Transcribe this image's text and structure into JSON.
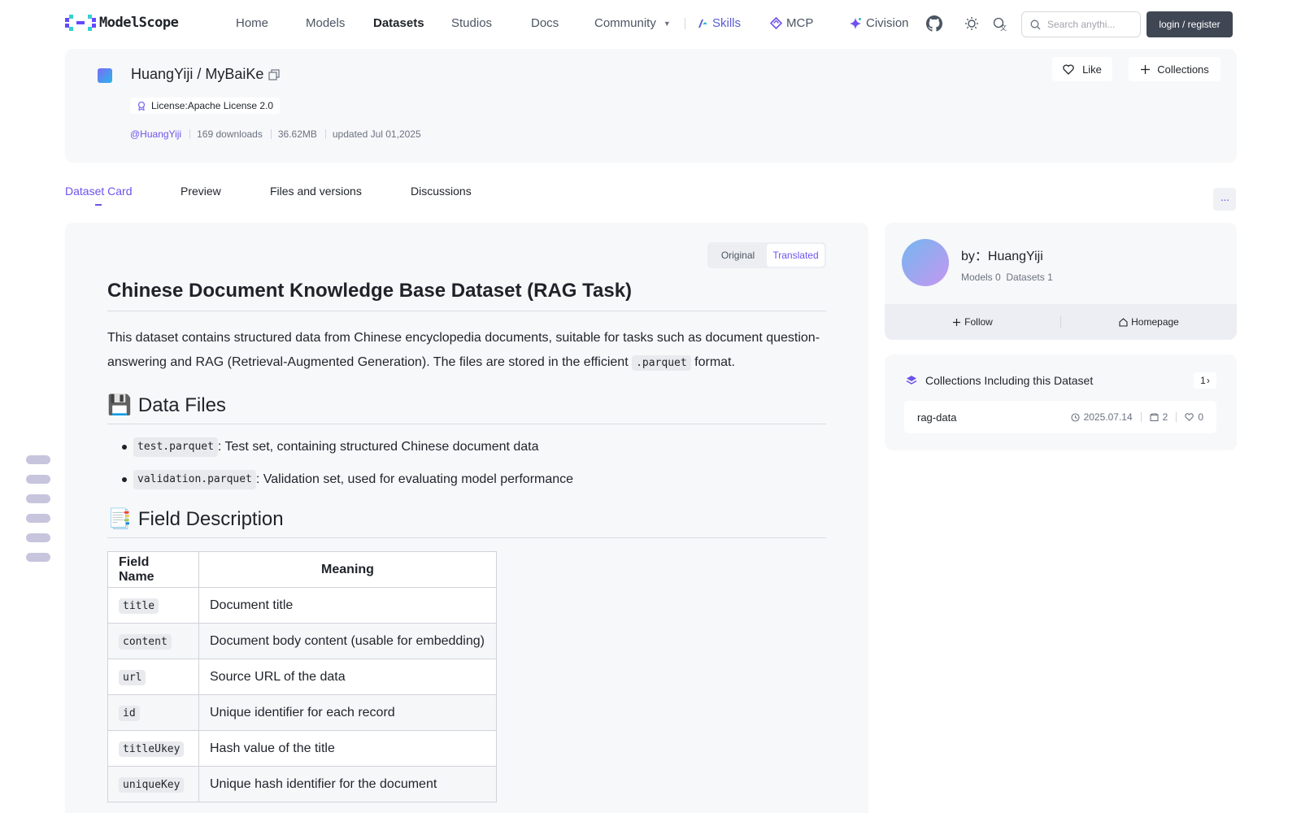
{
  "brand": {
    "logo_text": "ModelScope"
  },
  "nav": {
    "home": "Home",
    "models": "Models",
    "datasets": "Datasets",
    "studios": "Studios",
    "docs": "Docs",
    "community": "Community",
    "skills": "Skills",
    "mcp": "MCP",
    "civision": "Civision"
  },
  "search": {
    "placeholder": "Search anythi..."
  },
  "auth": {
    "login_label": "login / register"
  },
  "dataset": {
    "title": "HuangYiji / MyBaiKe",
    "license": "License:Apache License 2.0",
    "author": "@HuangYiji",
    "downloads": "169 downloads",
    "size": "36.62MB",
    "updated": "updated Jul 01,2025",
    "like_label": "Like",
    "collections_label": "Collections"
  },
  "tabs": {
    "card": "Dataset Card",
    "preview": "Preview",
    "files": "Files and versions",
    "discussions": "Discussions",
    "more": "···"
  },
  "lang_toggle": {
    "original": "Original",
    "translated": "Translated"
  },
  "card": {
    "heading": "Chinese Document Knowledge Base Dataset (RAG Task)",
    "intro_before": "This dataset contains structured data from Chinese encyclopedia documents, suitable for tasks such as document question-answering and RAG (Retrieval-Augmented Generation). The files are stored in the efficient ",
    "intro_code": ".parquet",
    "intro_after": " format.",
    "files_heading": "Data Files",
    "files_emoji": "💾",
    "files": [
      {
        "name": "test.parquet",
        "desc": ": Test set, containing structured Chinese document data"
      },
      {
        "name": "validation.parquet",
        "desc": ": Validation set, used for evaluating model performance"
      }
    ],
    "fields_heading": "Field Description",
    "fields_emoji": "📑",
    "table": {
      "headers": [
        "Field Name",
        "Meaning"
      ],
      "rows": [
        {
          "field": "title",
          "meaning": "Document title"
        },
        {
          "field": "content",
          "meaning": "Document body content (usable for embedding)"
        },
        {
          "field": "url",
          "meaning": "Source URL of the data"
        },
        {
          "field": "id",
          "meaning": "Unique identifier for each record"
        },
        {
          "field": "titleUkey",
          "meaning": "Hash value of the title"
        },
        {
          "field": "uniqueKey",
          "meaning": "Unique hash identifier for the document"
        }
      ]
    }
  },
  "author_card": {
    "by": "by：HuangYiji",
    "models": "Models 0",
    "datasets": "Datasets 1",
    "follow": "Follow",
    "homepage": "Homepage"
  },
  "collections_card": {
    "title": "Collections Including this Dataset",
    "count": "1",
    "item": {
      "name": "rag-data",
      "date": "2025.07.14",
      "datasets": "2",
      "likes": "0"
    }
  },
  "colors": {
    "accent": "#6f52ed",
    "panel": "#f7f8fa",
    "login_bg": "#3f4654"
  }
}
